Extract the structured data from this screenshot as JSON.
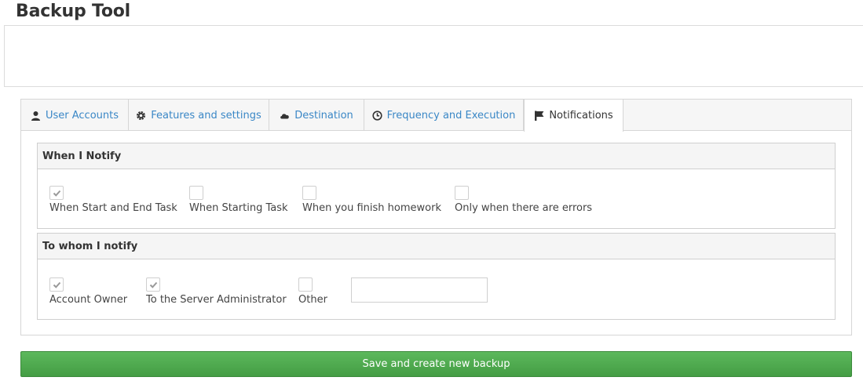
{
  "page": {
    "title": "Backup Tool"
  },
  "tabs": [
    {
      "label": "User Accounts",
      "icon": "user-icon",
      "active": false
    },
    {
      "label": "Features and settings",
      "icon": "gear-icon",
      "active": false
    },
    {
      "label": "Destination",
      "icon": "cloud-icon",
      "active": false
    },
    {
      "label": "Frequency and Execution",
      "icon": "clock-icon",
      "active": false
    },
    {
      "label": "Notifications",
      "icon": "flag-icon",
      "active": true
    }
  ],
  "when_notify": {
    "header": "When I Notify",
    "options": [
      {
        "label": "When Start and End Task",
        "checked": true
      },
      {
        "label": "When Starting Task",
        "checked": false
      },
      {
        "label": "When you finish homework",
        "checked": false
      },
      {
        "label": "Only when there are errors",
        "checked": false
      }
    ]
  },
  "to_whom": {
    "header": "To whom I notify",
    "options": [
      {
        "label": "Account Owner",
        "checked": true
      },
      {
        "label": "To the Server Administrator",
        "checked": true
      },
      {
        "label": "Other",
        "checked": false
      }
    ],
    "other_value": ""
  },
  "actions": {
    "save_label": "Save and create new backup"
  },
  "colors": {
    "link": "#3a87c6",
    "success": "#5cb85c",
    "check": "#999999"
  }
}
